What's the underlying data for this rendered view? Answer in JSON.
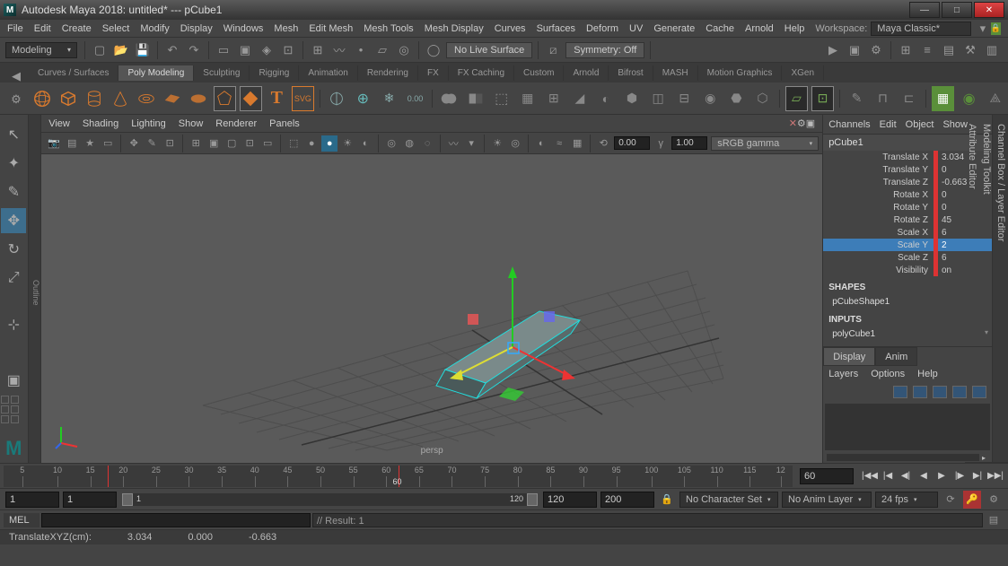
{
  "title": "Autodesk Maya 2018: untitled*  ---  pCube1",
  "menubar": [
    "File",
    "Edit",
    "Create",
    "Select",
    "Modify",
    "Display",
    "Windows",
    "Mesh",
    "Edit Mesh",
    "Mesh Tools",
    "Mesh Display",
    "Curves",
    "Surfaces",
    "Deform",
    "UV",
    "Generate",
    "Cache",
    "Arnold",
    "Help"
  ],
  "workspace_label": "Workspace:",
  "workspace_value": "Maya Classic*",
  "modeling_label": "Modeling",
  "no_live_surface": "No Live Surface",
  "symmetry": "Symmetry: Off",
  "shelfTabs": [
    "Curves / Surfaces",
    "Poly Modeling",
    "Sculpting",
    "Rigging",
    "Animation",
    "Rendering",
    "FX",
    "FX Caching",
    "Custom",
    "Arnold",
    "Bifrost",
    "MASH",
    "Motion Graphics",
    "XGen"
  ],
  "shelfActive": 1,
  "outliner_label": "Outline",
  "vpMenu": [
    "View",
    "Shading",
    "Lighting",
    "Show",
    "Renderer",
    "Panels"
  ],
  "vp_num1": "0.00",
  "vp_num2": "1.00",
  "vp_gamma": "sRGB gamma",
  "persp": "persp",
  "cbMenu": [
    "Channels",
    "Edit",
    "Object",
    "Show"
  ],
  "objectName": "pCube1",
  "attrs": [
    {
      "lbl": "Translate X",
      "val": "3.034"
    },
    {
      "lbl": "Translate Y",
      "val": "0"
    },
    {
      "lbl": "Translate Z",
      "val": "-0.663"
    },
    {
      "lbl": "Rotate X",
      "val": "0"
    },
    {
      "lbl": "Rotate Y",
      "val": "0"
    },
    {
      "lbl": "Rotate Z",
      "val": "45"
    },
    {
      "lbl": "Scale X",
      "val": "6"
    },
    {
      "lbl": "Scale Y",
      "val": "2"
    },
    {
      "lbl": "Scale Z",
      "val": "6"
    },
    {
      "lbl": "Visibility",
      "val": "on"
    }
  ],
  "attrSelected": 7,
  "shapes_label": "SHAPES",
  "shape_name": "pCubeShape1",
  "inputs_label": "INPUTS",
  "input_name": "polyCube1",
  "layerTabs": [
    "Display",
    "Anim"
  ],
  "layerMenu": [
    "Layers",
    "Options",
    "Help"
  ],
  "rightTabs": [
    "Channel Box / Layer Editor",
    "Modeling Toolkit",
    "Attribute Editor"
  ],
  "timeline_ticks": [
    "5",
    "10",
    "15",
    "20",
    "25",
    "30",
    "35",
    "40",
    "45",
    "50",
    "55",
    "60",
    "65",
    "70",
    "75",
    "80",
    "85",
    "90",
    "95",
    "100",
    "105",
    "110",
    "115",
    "12"
  ],
  "current_frame": "60",
  "range_start_outer": "1",
  "range_start_inner": "1",
  "range_end_inner": "120",
  "range_end_outer": "120",
  "range_box3": "200",
  "charset": "No Character Set",
  "animlayer": "No Anim Layer",
  "fps": "24 fps",
  "cmd_label": "MEL",
  "cmd_result": "// Result: 1",
  "helpline": {
    "a": "TranslateXYZ(cm):",
    "b": "3.034",
    "c": "0.000",
    "d": "-0.663"
  }
}
